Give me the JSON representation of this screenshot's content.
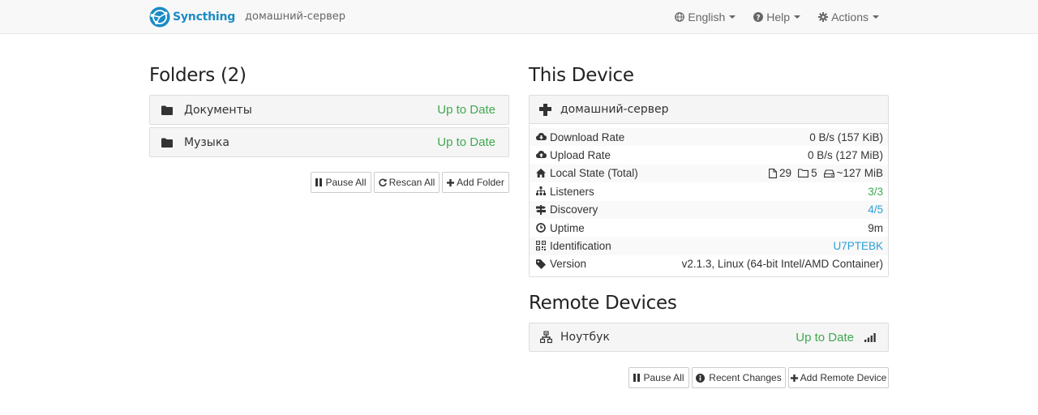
{
  "navbar": {
    "brand": "Syncthing",
    "device_name": "домашний-сервер",
    "language": "English",
    "help": "Help",
    "actions": "Actions"
  },
  "folders": {
    "title": "Folders (2)",
    "items": [
      {
        "label": "Документы",
        "status": "Up to Date"
      },
      {
        "label": "Музыка",
        "status": "Up to Date"
      }
    ],
    "buttons": {
      "pause_all": "Pause All",
      "rescan_all": "Rescan All",
      "add_folder": "Add Folder"
    }
  },
  "this_device": {
    "title": "This Device",
    "name": "домашний-сервер",
    "rows": [
      {
        "key": "Download Rate",
        "value": "0 B/s (157 KiB)"
      },
      {
        "key": "Upload Rate",
        "value": "0 B/s (127 MiB)"
      },
      {
        "key": "Local State (Total)",
        "files": "29",
        "dirs": "5",
        "size": "~127 MiB"
      },
      {
        "key": "Listeners",
        "value": "3/3"
      },
      {
        "key": "Discovery",
        "value": "4/5"
      },
      {
        "key": "Uptime",
        "value": "9m"
      },
      {
        "key": "Identification",
        "value": "U7PTEBK"
      },
      {
        "key": "Version",
        "value": "v2.1.3, Linux (64-bit Intel/AMD Container)"
      }
    ]
  },
  "remote_devices": {
    "title": "Remote Devices",
    "items": [
      {
        "label": "Ноутбук",
        "status": "Up to Date"
      }
    ],
    "buttons": {
      "pause_all": "Pause All",
      "recent_changes": "Recent Changes",
      "add_remote_device": "Add Remote Device"
    }
  },
  "colors": {
    "accent": "#1a8bc6",
    "status_ok": "#3fa950",
    "link": "#2a9fd6"
  }
}
